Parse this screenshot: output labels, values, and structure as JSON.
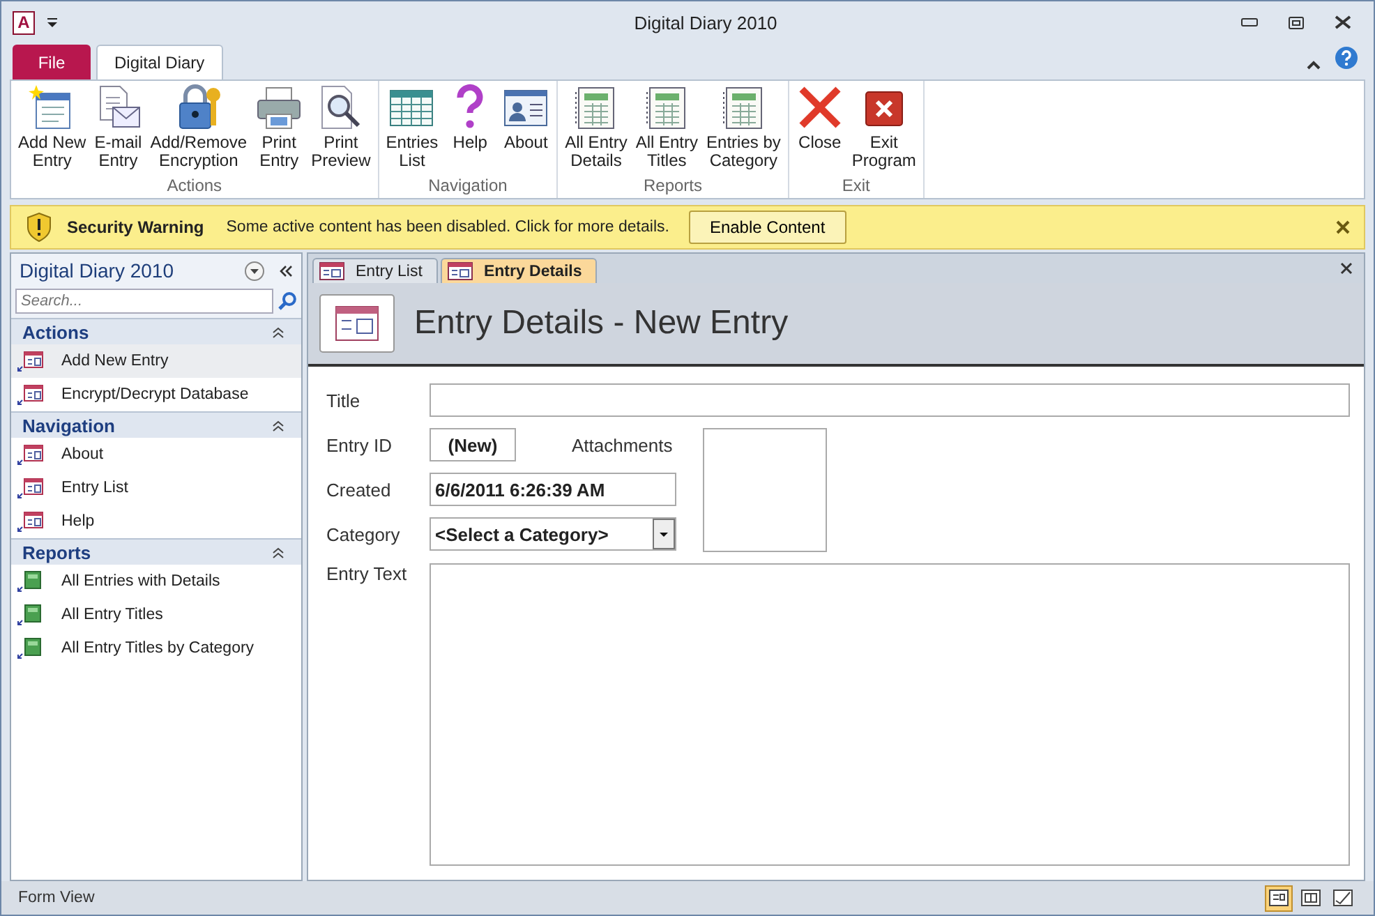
{
  "window": {
    "title": "Digital Diary 2010",
    "app_icon": "A"
  },
  "ribbon_tabs": [
    {
      "label": "File",
      "kind": "file",
      "selected": false
    },
    {
      "label": "Digital Diary",
      "kind": "tab",
      "selected": true
    }
  ],
  "ribbon_groups": [
    {
      "label": "Actions",
      "buttons": [
        {
          "lines": [
            "Add New",
            "Entry"
          ]
        },
        {
          "lines": [
            "E-mail",
            "Entry"
          ]
        },
        {
          "lines": [
            "Add/Remove",
            "Encryption"
          ]
        },
        {
          "lines": [
            "Print",
            "Entry"
          ]
        },
        {
          "lines": [
            "Print",
            "Preview"
          ]
        }
      ]
    },
    {
      "label": "Navigation",
      "buttons": [
        {
          "lines": [
            "Entries",
            "List"
          ]
        },
        {
          "lines": [
            "Help"
          ]
        },
        {
          "lines": [
            "About"
          ]
        }
      ]
    },
    {
      "label": "Reports",
      "buttons": [
        {
          "lines": [
            "All Entry",
            "Details"
          ]
        },
        {
          "lines": [
            "All Entry",
            "Titles"
          ]
        },
        {
          "lines": [
            "Entries by",
            "Category"
          ]
        }
      ]
    },
    {
      "label": "Exit",
      "buttons": [
        {
          "lines": [
            "Close"
          ]
        },
        {
          "lines": [
            "Exit",
            "Program"
          ]
        }
      ]
    }
  ],
  "security_bar": {
    "title": "Security Warning",
    "message": "Some active content has been disabled. Click for more details.",
    "button": "Enable Content"
  },
  "nav_pane": {
    "title": "Digital Diary 2010",
    "search": {
      "placeholder": "Search..."
    },
    "groups": [
      {
        "label": "Actions",
        "items": [
          {
            "label": "Add New Entry",
            "kind": "form",
            "selected": true
          },
          {
            "label": "Encrypt/Decrypt Database",
            "kind": "form",
            "selected": false
          }
        ]
      },
      {
        "label": "Navigation",
        "items": [
          {
            "label": "About",
            "kind": "form",
            "selected": false
          },
          {
            "label": "Entry List",
            "kind": "form",
            "selected": false
          },
          {
            "label": "Help",
            "kind": "form",
            "selected": false
          }
        ]
      },
      {
        "label": "Reports",
        "items": [
          {
            "label": "All Entries with Details",
            "kind": "report",
            "selected": false
          },
          {
            "label": "All Entry Titles",
            "kind": "report",
            "selected": false
          },
          {
            "label": "All Entry Titles by Category",
            "kind": "report",
            "selected": false
          }
        ]
      }
    ]
  },
  "doc_tabs": [
    {
      "label": "Entry List",
      "selected": false
    },
    {
      "label": "Entry Details",
      "selected": true
    }
  ],
  "form": {
    "heading": "Entry Details - New Entry",
    "title": {
      "label": "Title"
    },
    "entry_id": {
      "label": "Entry ID",
      "value": "(New)"
    },
    "attachments": {
      "label": "Attachments"
    },
    "created": {
      "label": "Created",
      "value": "6/6/2011 6:26:39 AM"
    },
    "category": {
      "label": "Category",
      "value": "<Select a Category>"
    },
    "entry_text": {
      "label": "Entry Text"
    }
  },
  "status_bar": {
    "text": "Form View",
    "views": [
      {
        "selected": true
      },
      {
        "selected": false
      },
      {
        "selected": false
      }
    ]
  }
}
